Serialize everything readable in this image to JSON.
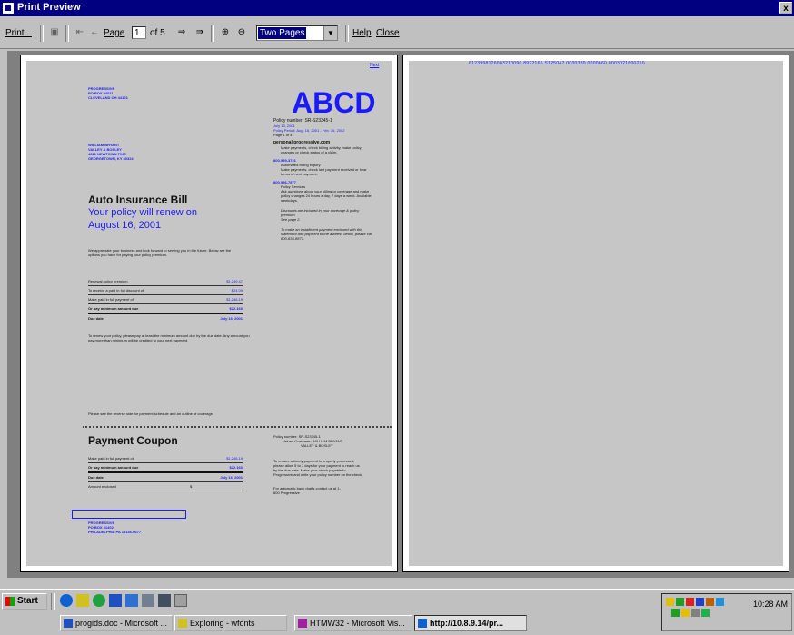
{
  "window": {
    "title": "Print Preview",
    "close_glyph": "x"
  },
  "toolbar": {
    "print_label": "Print...",
    "page_label": "Page",
    "page_value": "1",
    "of_label": "of 5",
    "view_mode": "Two Pages",
    "help_label": "Help",
    "close_label": "Close"
  },
  "bill": {
    "corner_mark": "Next",
    "sender_lines": [
      "PROGRESSIVE",
      "PO BOX 94011",
      "CLEVELAND OH 44101"
    ],
    "logo_text": "ABCD",
    "addressee_lines": [
      "WILLIAM BRYANT",
      "VALLEY & BOSLEY",
      "4321 NEWTOWN PIKE",
      "GEORGETOWN, KY 40324"
    ],
    "title": "Auto Insurance Bill",
    "subtitle": "Your policy will renew on",
    "renew_date": "August 16, 2001",
    "intro_text": "We appreciate your business and look forward to serving you in the future. Below are the options you have for paying your policy premium.",
    "rows": [
      {
        "label": "Renewal policy premium",
        "value": "$1,249.47"
      },
      {
        "label": "To receive a paid in full discount of",
        "value": "$24.09"
      },
      {
        "label": "Make paid in full payment of",
        "value": "$1,246.19"
      },
      {
        "label": "Or pay minimum amount due",
        "value": "$22.160"
      },
      {
        "label": "Due date",
        "value": "July 16, 2001"
      }
    ],
    "renew_note": "To renew your policy, please pay at least the minimum amount due by the due date. Any amount you pay more than minimum will be credited to your next payment.",
    "footer_note": "Please see the reverse side for payment schedule and an outline of coverage.",
    "policy_number_label": "Policy number",
    "policy_number": "SR-S23345-1",
    "policy_detail_lines": [
      "July 13, 2001",
      "Policy Period: Aug. 16, 2001 - Feb. 16, 2002",
      "Page 1 of 4"
    ],
    "contact_heading": "personal progressive.com",
    "contact_lines": [
      "Make payments, check billing activity, make policy changes or check status of a claim."
    ],
    "phone1": "800-999-3721",
    "phone1_lines": [
      "Automated billing inquiry",
      "Make payments, check last payment received or hear terms of next payment."
    ],
    "phone2": "800-956-7877",
    "phone2_lines": [
      "Policy Services",
      "Ask questions about your billing or coverage and make policy changes 24 hours a day, 7 days a week. Available weekdays."
    ],
    "italic_lines": [
      "Discounts are included in your coverage & policy premium.",
      "See page 2.",
      "To make an installment payment enclosed with this statement and payment to the address below, please call 800-835-8877."
    ],
    "coupon_title": "Payment Coupon",
    "coupon_rows": [
      {
        "label": "Make paid in full payment of",
        "value": "$1,246.19"
      },
      {
        "label": "Or pay minimum amount due",
        "value": "$22.160"
      },
      {
        "label": "Due date",
        "value": "July 16, 2001"
      },
      {
        "label": "Amount enclosed",
        "value": "$"
      }
    ],
    "coupon_policy_label": "Policy number",
    "coupon_policy": "SR-S23345-1",
    "coupon_name_lines": [
      "Valued Customer: WILLIAM BRYANT",
      "VALLEY & BOSLEY"
    ],
    "coupon_note": "To ensure a timely payment is properly processed, please allow 5 to 7 days for your payment to reach us by the due date. Make your check payable to Progressive and write your policy number on the check.",
    "coupon_note2": "For automatic bank drafts contact us at 1-800 Progressive",
    "remit_lines": [
      "PROGRESSIVE",
      "PO BOX 31402",
      "PHILADELPHIA PA 19136-0677"
    ],
    "barcode_text": "6123998126003210090 8922166 S125047 0000330 0000660 0003021600210"
  },
  "taskbar": {
    "start_label": "Start",
    "tasks": [
      "progids.doc - Microsoft ...",
      "Exploring - wfonts",
      "HTMW32 - Microsoft Vis...",
      "http://10.8.9.14/pr..."
    ],
    "clock": "10:28 AM"
  }
}
